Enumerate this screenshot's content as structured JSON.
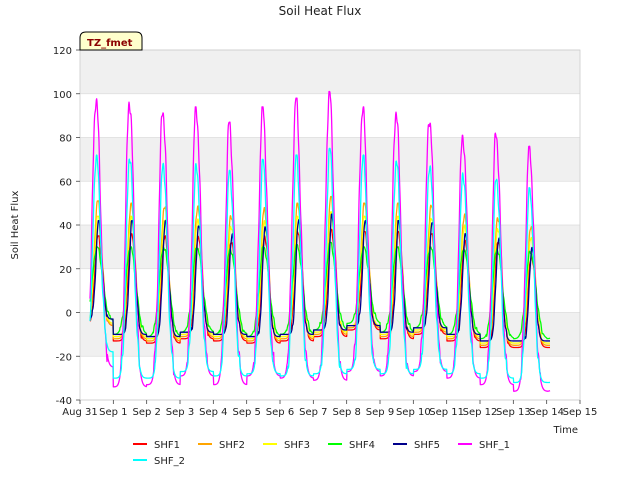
{
  "chart_data": {
    "type": "line",
    "title": "Soil Heat Flux",
    "xlabel": "Time",
    "ylabel": "Soil Heat Flux",
    "badge": "TZ_fmet",
    "ylim": [
      -40,
      120
    ],
    "yticks": [
      -40,
      -20,
      0,
      20,
      40,
      60,
      80,
      100,
      120
    ],
    "xlim": [
      0,
      15
    ],
    "xticks": [
      {
        "x": 0,
        "label": "Aug 31"
      },
      {
        "x": 1,
        "label": "Sep 1"
      },
      {
        "x": 2,
        "label": "Sep 2"
      },
      {
        "x": 3,
        "label": "Sep 3"
      },
      {
        "x": 4,
        "label": "Sep 4"
      },
      {
        "x": 5,
        "label": "Sep 5"
      },
      {
        "x": 6,
        "label": "Sep 6"
      },
      {
        "x": 7,
        "label": "Sep 7"
      },
      {
        "x": 8,
        "label": "Sep 8"
      },
      {
        "x": 9,
        "label": "Sep 9"
      },
      {
        "x": 10,
        "label": "Sep 10"
      },
      {
        "x": 11,
        "label": "Sep 11"
      },
      {
        "x": 12,
        "label": "Sep 12"
      },
      {
        "x": 13,
        "label": "Sep 13"
      },
      {
        "x": 14,
        "label": "Sep 14"
      },
      {
        "x": 15,
        "label": "Sep 15"
      }
    ],
    "days": [
      "Aug 31",
      "Sep 1",
      "Sep 2",
      "Sep 3",
      "Sep 4",
      "Sep 5",
      "Sep 6",
      "Sep 7",
      "Sep 8",
      "Sep 9",
      "Sep 10",
      "Sep 11",
      "Sep 12",
      "Sep 13"
    ],
    "grid": true,
    "legend_position": "bottom",
    "series": [
      {
        "name": "SHF1",
        "color": "#ff0000",
        "daily_max": [
          35,
          36,
          35,
          35,
          33,
          35,
          37,
          38,
          37,
          37,
          36,
          33,
          33,
          26
        ],
        "daily_min": [
          -6,
          -13,
          -14,
          -12,
          -13,
          -14,
          -13,
          -11,
          -8,
          -12,
          -10,
          -13,
          -16,
          -16
        ]
      },
      {
        "name": "SHF2",
        "color": "#ffa500",
        "daily_max": [
          51,
          50,
          49,
          49,
          45,
          48,
          50,
          53,
          50,
          50,
          49,
          45,
          44,
          40
        ],
        "daily_min": [
          -6,
          -12,
          -13,
          -11,
          -12,
          -13,
          -12,
          -10,
          -7,
          -11,
          -9,
          -12,
          -15,
          -15
        ]
      },
      {
        "name": "SHF3",
        "color": "#ffff00",
        "daily_max": [
          44,
          44,
          43,
          43,
          40,
          42,
          44,
          46,
          44,
          44,
          43,
          40,
          39,
          35
        ],
        "daily_min": [
          -5,
          -11,
          -12,
          -10,
          -11,
          -12,
          -11,
          -9,
          -6,
          -10,
          -8,
          -11,
          -14,
          -14
        ]
      },
      {
        "name": "SHF4",
        "color": "#00ff00",
        "daily_max": [
          30,
          30,
          30,
          30,
          29,
          30,
          31,
          32,
          30,
          30,
          30,
          29,
          29,
          28
        ],
        "daily_min": [
          -4,
          -10,
          -11,
          -9,
          -10,
          -11,
          -10,
          -8,
          -5,
          -9,
          -7,
          -10,
          -12,
          -12
        ]
      },
      {
        "name": "SHF5",
        "color": "#00008b",
        "daily_max": [
          42,
          42,
          42,
          40,
          36,
          40,
          43,
          45,
          42,
          42,
          41,
          36,
          34,
          30
        ],
        "daily_min": [
          -3,
          -10,
          -11,
          -9,
          -10,
          -11,
          -10,
          -8,
          -6,
          -9,
          -7,
          -10,
          -13,
          -13
        ]
      },
      {
        "name": "SHF_1",
        "color": "#ff00ff",
        "daily_max": [
          98,
          97,
          93,
          94,
          87,
          94,
          98,
          101,
          94,
          92,
          89,
          81,
          82,
          76
        ],
        "daily_min": [
          -25,
          -34,
          -33,
          -29,
          -33,
          -29,
          -30,
          -31,
          -27,
          -29,
          -27,
          -30,
          -33,
          -36
        ]
      },
      {
        "name": "SHF_2",
        "color": "#00ffff",
        "daily_max": [
          72,
          72,
          69,
          68,
          65,
          70,
          72,
          75,
          72,
          70,
          68,
          64,
          62,
          57
        ],
        "daily_min": [
          -18,
          -30,
          -30,
          -27,
          -29,
          -28,
          -29,
          -28,
          -26,
          -28,
          -26,
          -28,
          -30,
          -32
        ]
      }
    ]
  }
}
